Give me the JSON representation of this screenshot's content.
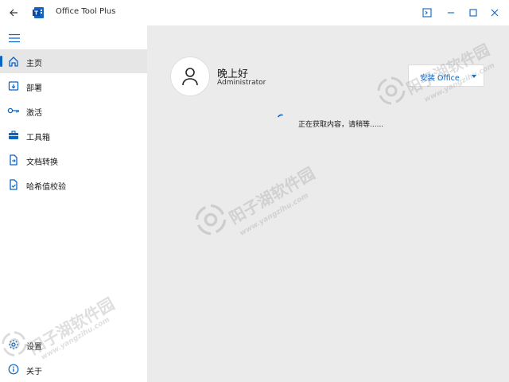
{
  "window": {
    "title": "Office Tool Plus"
  },
  "sidebar": {
    "items": [
      {
        "label": "主页",
        "icon": "home-icon",
        "active": true
      },
      {
        "label": "部署",
        "icon": "deploy-icon",
        "active": false
      },
      {
        "label": "激活",
        "icon": "key-icon",
        "active": false
      },
      {
        "label": "工具箱",
        "icon": "toolbox-icon",
        "active": false
      },
      {
        "label": "文档转换",
        "icon": "document-convert-icon",
        "active": false
      },
      {
        "label": "哈希值校验",
        "icon": "document-check-icon",
        "active": false
      }
    ],
    "bottom_items": [
      {
        "label": "设置",
        "icon": "gear-icon"
      },
      {
        "label": "关于",
        "icon": "info-icon"
      }
    ]
  },
  "main": {
    "greeting": "晚上好",
    "username": "Administrator",
    "install_button": "安装 Office",
    "loading_text": "正在获取内容，请稍等......"
  },
  "watermark": {
    "text": "阳子湖软件园",
    "url": "www.yangzihu.com"
  },
  "colors": {
    "accent": "#0a64c2",
    "sidebar_bg": "#ffffff",
    "main_bg": "#ebebeb",
    "active_item_bg": "#e6e6e6"
  }
}
